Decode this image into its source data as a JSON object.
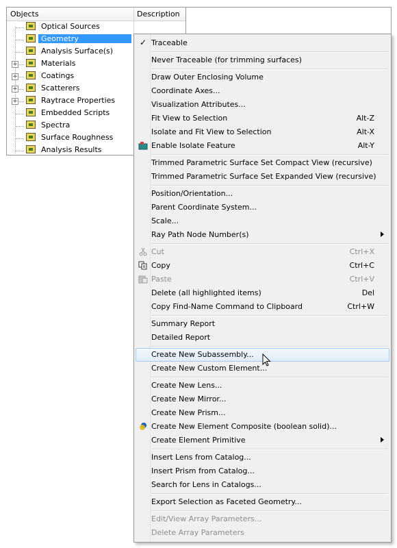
{
  "tree": {
    "col_objects": "Objects",
    "col_description": "Description",
    "items": [
      {
        "label": "Optical Sources",
        "expander": "",
        "icon": "optical-sources-icon"
      },
      {
        "label": "Geometry",
        "expander": "",
        "icon": "geometry-icon",
        "selected": true
      },
      {
        "label": "Analysis Surface(s)",
        "expander": "",
        "icon": "analysis-surface-icon"
      },
      {
        "label": "Materials",
        "expander": "+",
        "icon": "materials-icon"
      },
      {
        "label": "Coatings",
        "expander": "+",
        "icon": "coatings-icon"
      },
      {
        "label": "Scatterers",
        "expander": "+",
        "icon": "scatterers-icon"
      },
      {
        "label": "Raytrace Properties",
        "expander": "+",
        "icon": "raytrace-properties-icon"
      },
      {
        "label": "Embedded Scripts",
        "expander": "",
        "icon": "embedded-scripts-icon"
      },
      {
        "label": "Spectra",
        "expander": "",
        "icon": "spectra-icon"
      },
      {
        "label": "Surface Roughness",
        "expander": "",
        "icon": "surface-roughness-icon"
      },
      {
        "label": "Analysis Results",
        "expander": "",
        "icon": "analysis-results-icon"
      }
    ]
  },
  "menu": {
    "traceable": "Traceable",
    "never_traceable": "Never Traceable (for trimming surfaces)",
    "draw_outer": "Draw Outer Enclosing Volume",
    "coordinate_axes": "Coordinate Axes...",
    "visualization": "Visualization Attributes...",
    "fit_view": "Fit View to Selection",
    "fit_view_sc": "Alt-Z",
    "isolate_fit": "Isolate and Fit View to Selection",
    "isolate_fit_sc": "Alt-X",
    "enable_isolate": "Enable Isolate Feature",
    "enable_isolate_sc": "Alt-Y",
    "trimmed_compact": "Trimmed Parametric Surface Set Compact View (recursive)",
    "trimmed_expanded": "Trimmed Parametric Surface Set Expanded View (recursive)",
    "position": "Position/Orientation...",
    "parent_cs": "Parent Coordinate System...",
    "scale": "Scale...",
    "ray_path": "Ray Path Node Number(s)",
    "cut": "Cut",
    "cut_sc": "Ctrl+X",
    "copy": "Copy",
    "copy_sc": "Ctrl+C",
    "paste": "Paste",
    "paste_sc": "Ctrl+V",
    "delete": "Delete (all highlighted items)",
    "delete_sc": "Del",
    "copy_find": "Copy Find-Name Command to Clipboard",
    "copy_find_sc": "Ctrl+W",
    "summary": "Summary Report",
    "detailed": "Detailed Report",
    "new_subassembly": "Create New Subassembly...",
    "new_custom": "Create New Custom Element...",
    "new_lens": "Create New Lens...",
    "new_mirror": "Create New Mirror...",
    "new_prism": "Create New Prism...",
    "new_composite": "Create New Element Composite (boolean solid)...",
    "element_primitive": "Create Element Primitive",
    "insert_lens": "Insert Lens from Catalog...",
    "insert_prism": "Insert Prism from Catalog...",
    "search_lens": "Search for Lens in Catalogs...",
    "export_faceted": "Export Selection as Faceted Geometry...",
    "edit_array": "Edit/View Array Parameters...",
    "delete_array": "Delete Array Parameters"
  },
  "colors": {
    "selection": "#3399ff",
    "menu_bg": "#f0f0f0",
    "hover_border": "#a8caf0"
  }
}
